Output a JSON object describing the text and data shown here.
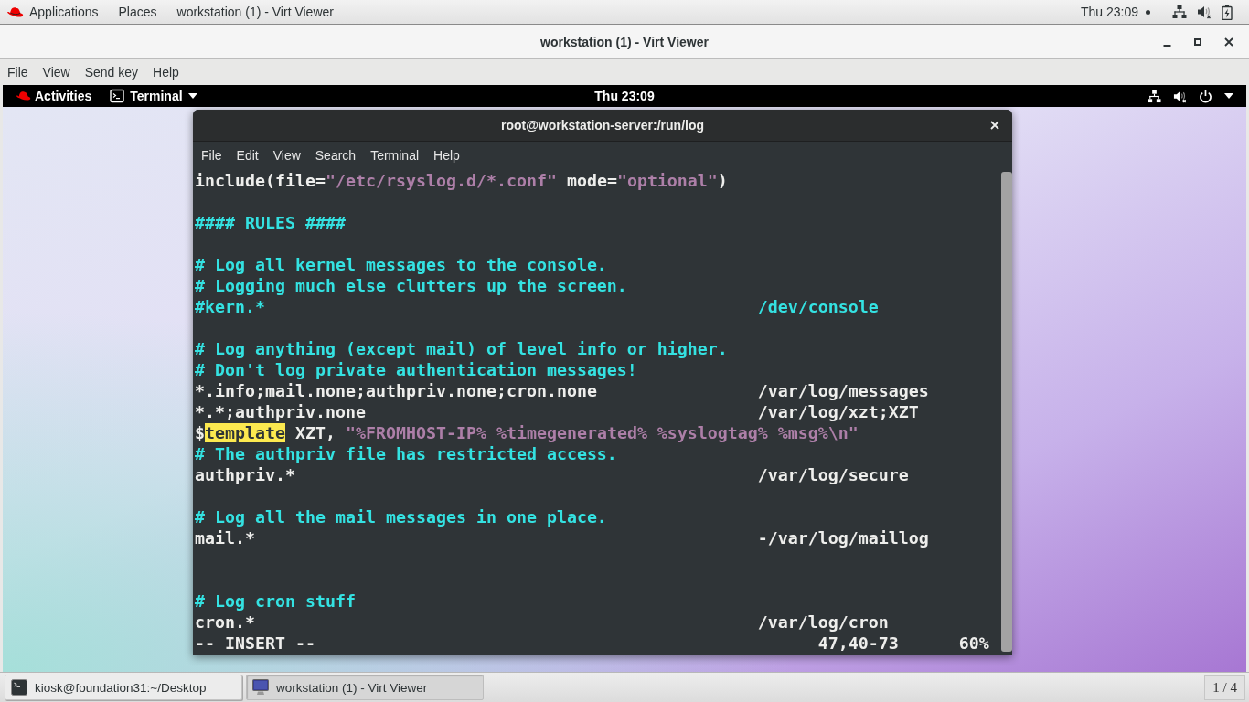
{
  "host_top_bar": {
    "menus": [
      "Applications",
      "Places"
    ],
    "window_title": "workstation (1) - Virt Viewer",
    "clock": "Thu 23:09"
  },
  "viewer_window": {
    "title": "workstation (1) - Virt Viewer",
    "menu": [
      "File",
      "View",
      "Send key",
      "Help"
    ]
  },
  "guest_top_bar": {
    "activities": "Activities",
    "app_menu": "Terminal",
    "clock": "Thu 23:09"
  },
  "terminal": {
    "title": "root@workstation-server:/run/log",
    "menu": [
      "File",
      "Edit",
      "View",
      "Search",
      "Terminal",
      "Help"
    ],
    "lines": [
      {
        "kind": "code",
        "segments": [
          {
            "text": "include(file=",
            "kind": "plain"
          },
          {
            "text": "\"/etc/rsyslog.d/*.conf\"",
            "kind": "string"
          },
          {
            "text": " mode=",
            "kind": "plain"
          },
          {
            "text": "\"optional\"",
            "kind": "string"
          },
          {
            "text": ")",
            "kind": "plain"
          }
        ]
      },
      {
        "kind": "blank"
      },
      {
        "kind": "code",
        "segments": [
          {
            "text": "#### RULES ####",
            "kind": "comment"
          }
        ]
      },
      {
        "kind": "blank"
      },
      {
        "kind": "code",
        "segments": [
          {
            "text": "# Log all kernel messages to the console.",
            "kind": "comment"
          }
        ]
      },
      {
        "kind": "code",
        "segments": [
          {
            "text": "# Logging much else clutters up the screen.",
            "kind": "comment"
          }
        ]
      },
      {
        "kind": "code",
        "segments": [
          {
            "text": "#kern.*",
            "kind": "comment"
          }
        ],
        "target": {
          "text": "/dev/console",
          "kind": "comment"
        }
      },
      {
        "kind": "blank"
      },
      {
        "kind": "code",
        "segments": [
          {
            "text": "# Log anything (except mail) of level info or higher.",
            "kind": "comment"
          }
        ]
      },
      {
        "kind": "code",
        "segments": [
          {
            "text": "# Don't log private authentication messages!",
            "kind": "comment"
          }
        ]
      },
      {
        "kind": "code",
        "segments": [
          {
            "text": "*.info;mail.none;authpriv.none;cron.none",
            "kind": "plain"
          }
        ],
        "target": {
          "text": "/var/log/messages",
          "kind": "plain"
        }
      },
      {
        "kind": "code",
        "segments": [
          {
            "text": "*.*;authpriv.none",
            "kind": "plain"
          }
        ],
        "target": {
          "text": "/var/log/xzt;XZT",
          "kind": "plain"
        }
      },
      {
        "kind": "code",
        "segments": [
          {
            "text": "$",
            "kind": "plain"
          },
          {
            "text": "template",
            "kind": "highlight"
          },
          {
            "text": " XZT, ",
            "kind": "plain"
          },
          {
            "text": "\"%FROMHOST-IP% %timegenerated% %syslogtag% %msg%\\n\"",
            "kind": "string"
          }
        ]
      },
      {
        "kind": "code",
        "segments": [
          {
            "text": "# The authpriv file has restricted access.",
            "kind": "comment"
          }
        ]
      },
      {
        "kind": "code",
        "segments": [
          {
            "text": "authpriv.*",
            "kind": "plain"
          }
        ],
        "target": {
          "text": "/var/log/secure",
          "kind": "plain"
        }
      },
      {
        "kind": "blank"
      },
      {
        "kind": "code",
        "segments": [
          {
            "text": "# Log all the mail messages in one place.",
            "kind": "comment"
          }
        ]
      },
      {
        "kind": "code",
        "segments": [
          {
            "text": "mail.*",
            "kind": "plain"
          }
        ],
        "target": {
          "text": "-/var/log/maillog",
          "kind": "plain"
        }
      },
      {
        "kind": "blank"
      },
      {
        "kind": "blank"
      },
      {
        "kind": "code",
        "segments": [
          {
            "text": "# Log cron stuff",
            "kind": "comment"
          }
        ]
      },
      {
        "kind": "code",
        "segments": [
          {
            "text": "cron.*",
            "kind": "plain"
          }
        ],
        "target": {
          "text": "/var/log/cron",
          "kind": "plain"
        }
      }
    ],
    "status": {
      "mode": "-- INSERT --",
      "position": "47,40-73",
      "scroll": "60%"
    }
  },
  "taskbar": {
    "tasks": [
      {
        "label": "kiosk@foundation31:~/Desktop",
        "kind": "terminal",
        "selected": false
      },
      {
        "label": "workstation (1) - Virt Viewer",
        "kind": "viewer",
        "selected": true
      }
    ],
    "workspace": "1 / 4"
  }
}
